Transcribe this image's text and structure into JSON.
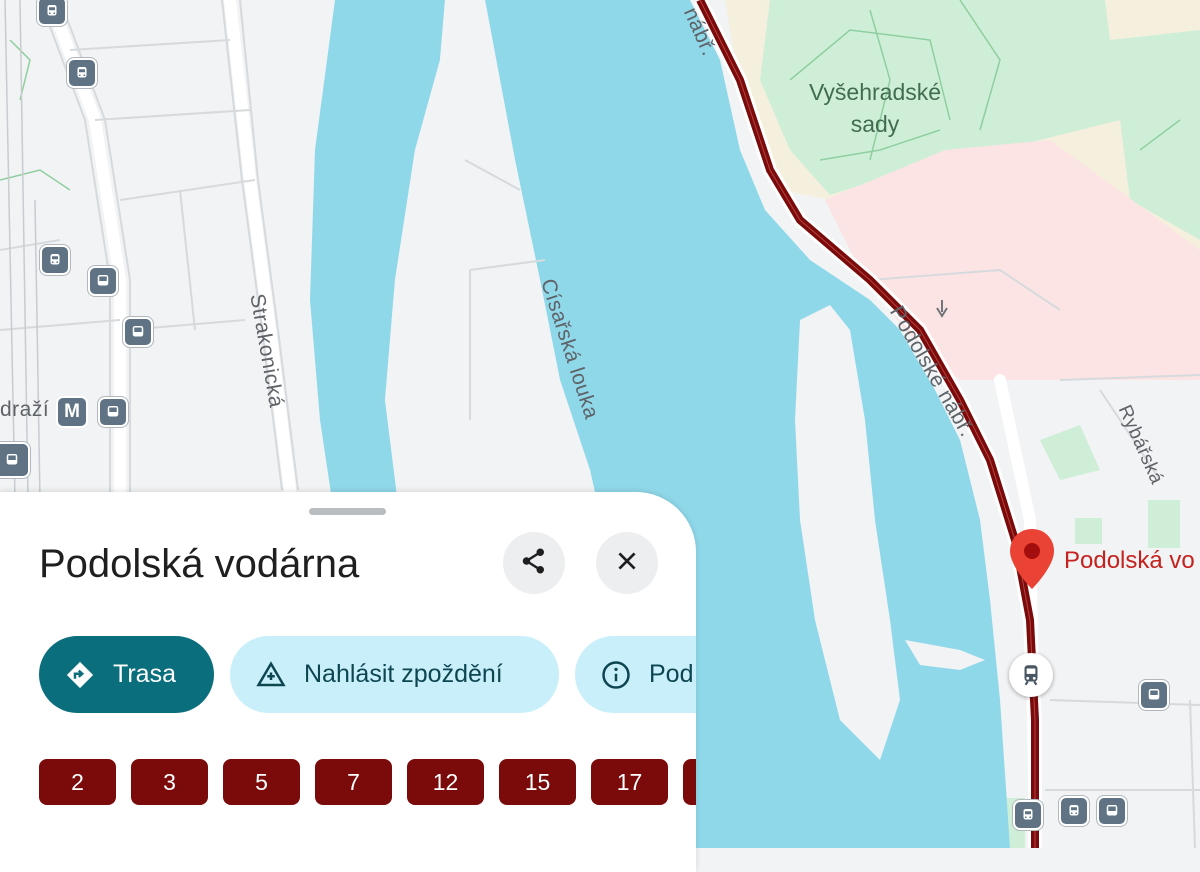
{
  "map": {
    "streets": {
      "strakonicka": "Strakonická",
      "cisarska_louka": "Císařská louka",
      "podolske_nabr": "Podolské nábř.",
      "podolske_nabr_top": "nábř.",
      "rybarska": "Rybářská",
      "nadrazi_partial": "draží"
    },
    "park_label": [
      "Vyšehradské",
      "sady"
    ],
    "poi": {
      "name": "Podolská vo",
      "color": "#d93025"
    },
    "metro_symbol": "M",
    "colors": {
      "water": "#8fd8ea",
      "park": "#cfeed8",
      "urban": "#f5efdd",
      "hospital": "#fce4e4",
      "tram_route": "#7b0b0b"
    }
  },
  "place": {
    "title": "Podolská vodárna",
    "share_icon": "share-icon",
    "close_icon": "close-icon"
  },
  "actions": [
    {
      "label": "Trasa",
      "icon": "directions-icon"
    },
    {
      "label": "Nahlásit zpoždění",
      "icon": "report-delay-icon"
    },
    {
      "label": "Pod",
      "icon": "info-icon"
    }
  ],
  "lines": [
    "2",
    "3",
    "5",
    "7",
    "12",
    "15",
    "17",
    ""
  ]
}
